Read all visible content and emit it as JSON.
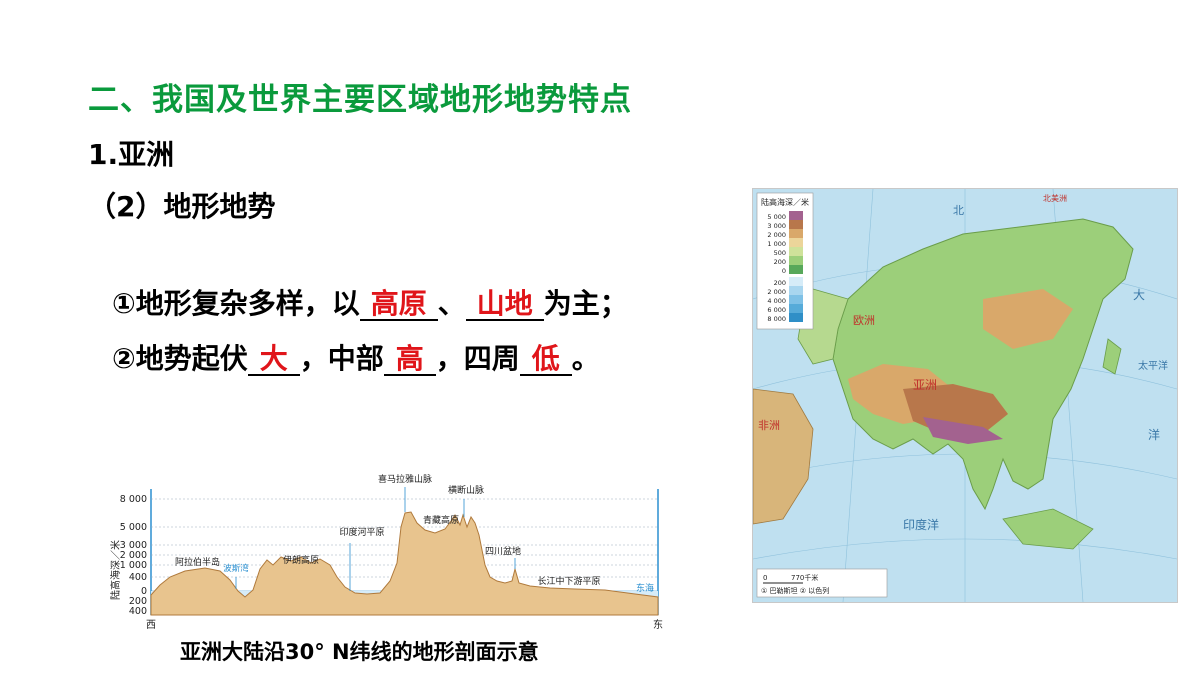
{
  "section_title": "二、我国及世界主要区域地形地势特点",
  "sub_title": "1.亚洲",
  "sub_sub_title": "（2）地形地势",
  "line1": {
    "prefix": "①地形复杂多样，以",
    "blank1": "高原",
    "sep": "、",
    "blank2": "山地",
    "suffix": "为主；"
  },
  "line2": {
    "prefix": "②地势起伏",
    "blank1": "大",
    "mid1": "，中部",
    "blank2": "高",
    "mid2": "，四周",
    "blank3": "低",
    "suffix": "。"
  },
  "profile": {
    "caption": "亚洲大陆沿30° N纬线的地形剖面示意",
    "ylabel": "陆高海深／米",
    "yticks": [
      "8 000",
      "5 000",
      "3 000",
      "2 000",
      "1 000",
      "400",
      "0",
      "200",
      "400"
    ],
    "west": "西",
    "east": "东",
    "labels": {
      "arabia": "阿拉伯半岛",
      "persian_gulf": "波斯湾",
      "iran": "伊朗高原",
      "indus": "印度河平原",
      "himalaya": "喜马拉雅山脉",
      "hengduan": "横断山脉",
      "tibet": "青藏高原",
      "sichuan": "四川盆地",
      "yangtze": "长江中下游平原",
      "east_sea": "东海"
    }
  },
  "map": {
    "legend_title": "陆高海深／米",
    "legend_land": [
      "5 000",
      "3 000",
      "2 000",
      "1 000",
      "500",
      "200",
      "0"
    ],
    "legend_sea": [
      "200",
      "2 000",
      "4 000",
      "6 000",
      "8 000"
    ],
    "scale": "770千米",
    "scale_zero": "0",
    "footnote": "① 巴勒斯坦  ② 以色列",
    "labels": {
      "europe": "欧洲",
      "asia": "亚洲",
      "pacific": "太平洋",
      "indian": "印度洋",
      "africa": "非洲",
      "north": "北",
      "top_label": "北美洲",
      "da_label": "大",
      "yang_label": "洋"
    }
  }
}
